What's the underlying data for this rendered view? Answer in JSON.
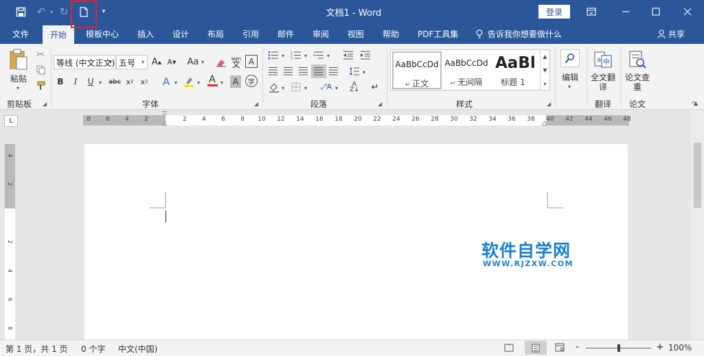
{
  "titlebar": {
    "title": "文档1 - Word",
    "login_label": "登录",
    "quick_access": [
      "save-icon",
      "undo-icon",
      "redo-icon",
      "new-document-icon",
      "customize-quick-access-icon"
    ],
    "accent_color": "#2b579a",
    "highlight_color": "#e0262b"
  },
  "tabs": [
    "文件",
    "开始",
    "模板中心",
    "插入",
    "设计",
    "布局",
    "引用",
    "邮件",
    "审阅",
    "视图",
    "帮助",
    "PDF工具集"
  ],
  "active_tab": "开始",
  "tell_me": "告诉我你想要做什么",
  "share_label": "共享",
  "ribbon": {
    "clipboard": {
      "paste": "粘贴",
      "label": "剪贴板"
    },
    "font": {
      "font_name": "等线 (中文正文)",
      "font_size": "五号",
      "label": "字体"
    },
    "paragraph": {
      "label": "段落"
    },
    "styles": {
      "label": "样式",
      "items": [
        {
          "sample": "AaBbCcDd",
          "name": "正文"
        },
        {
          "sample": "AaBbCcDd",
          "name": "无间隔"
        },
        {
          "sample": "AaBl",
          "name": "标题 1"
        }
      ]
    },
    "editing": {
      "label": "编辑"
    },
    "translate": {
      "button": "全文翻译",
      "label": "翻译"
    },
    "paper": {
      "button": "论文查重",
      "label": "论文"
    }
  },
  "ruler": {
    "tab_selector": "L",
    "h_labels": [
      "8",
      "6",
      "4",
      "2",
      "",
      "2",
      "4",
      "6",
      "8",
      "10",
      "12",
      "14",
      "16",
      "18",
      "20",
      "22",
      "24",
      "26",
      "28",
      "30",
      "32",
      "34",
      "36",
      "38",
      "40",
      "42",
      "44",
      "46",
      "48"
    ],
    "v_labels": [
      "4",
      "2",
      "",
      "2",
      "4",
      "6",
      "8"
    ]
  },
  "watermark": {
    "cn": "软件自学网",
    "en": "WWW.RJZXW.COM"
  },
  "statusbar": {
    "page_info": "第 1 页，共 1 页",
    "word_count": "0 个字",
    "language": "中文(中国)",
    "zoom_level": "100%",
    "zoom_minus": "-",
    "zoom_plus": "+"
  }
}
